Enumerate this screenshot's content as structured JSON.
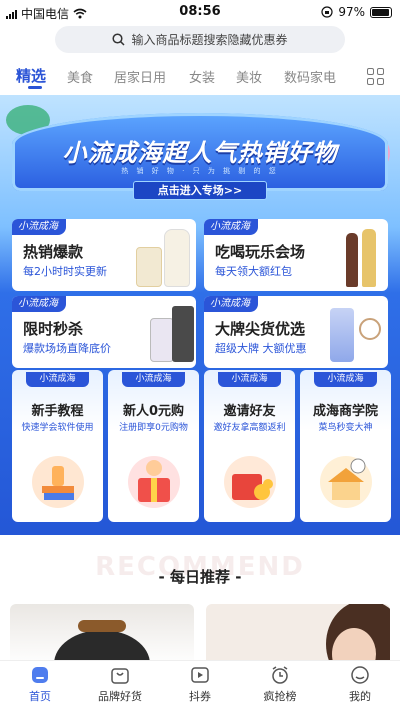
{
  "status_bar": {
    "carrier": "中国电信",
    "time": "08:56",
    "battery": "97%"
  },
  "search": {
    "placeholder": "输入商品标题搜索隐藏优惠券"
  },
  "tabs": [
    {
      "label": "精选",
      "active": true
    },
    {
      "label": "美食"
    },
    {
      "label": "居家日用"
    },
    {
      "label": "女装"
    },
    {
      "label": "美妆"
    },
    {
      "label": "数码家电"
    }
  ],
  "banner": {
    "title": "小流成海超人气热销好物",
    "subtitle": "热 销 好 物 · 只 为 挑 剔 的 您",
    "button": "点击进入专场>>"
  },
  "brand_tag": "小流成海",
  "promo_cards": [
    {
      "title": "热销爆款",
      "desc": "每2小时时实更新"
    },
    {
      "title": "吃喝玩乐会场",
      "desc": "每天领大额红包"
    },
    {
      "title": "限时秒杀",
      "desc": "爆款场场直降底价"
    },
    {
      "title": "大牌尖货优选",
      "desc": "超级大牌 大额优惠"
    }
  ],
  "small_cards": [
    {
      "title": "新手教程",
      "desc": "快速学会软件使用"
    },
    {
      "title": "新人0元购",
      "desc": "注册即享0元购物"
    },
    {
      "title": "邀请好友",
      "desc": "邀好友拿高额返利"
    },
    {
      "title": "成海商学院",
      "desc": "菜鸟秒变大神"
    }
  ],
  "recommend": {
    "watermark": "RECOMMEND",
    "title": "- 每日推荐 -"
  },
  "bottom_nav": [
    {
      "label": "首页",
      "active": true
    },
    {
      "label": "品牌好货"
    },
    {
      "label": "抖券"
    },
    {
      "label": "疯抢榜"
    },
    {
      "label": "我的"
    }
  ],
  "colors": {
    "accent": "#2b54d6",
    "card_desc": "#2b55d8"
  }
}
